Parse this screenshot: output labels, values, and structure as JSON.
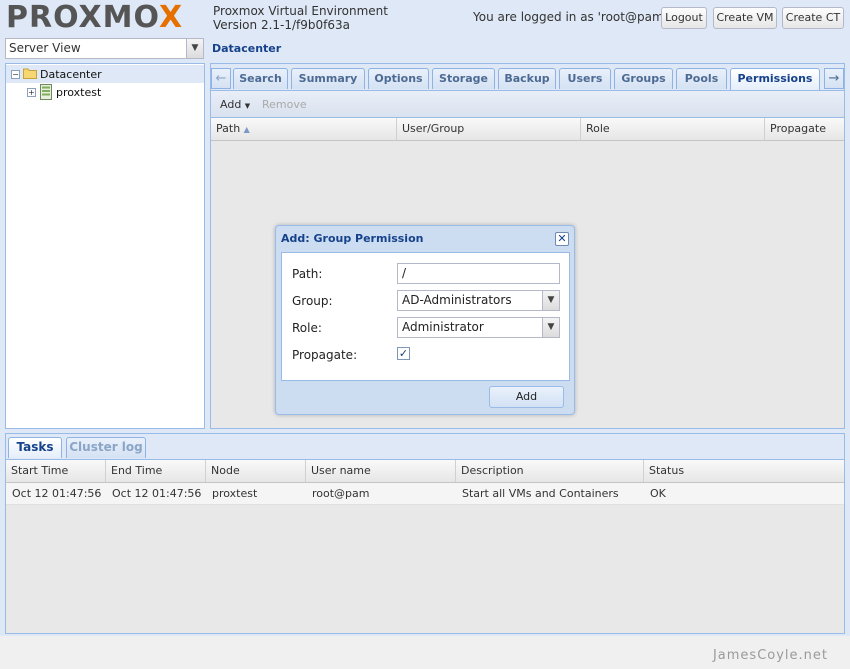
{
  "header": {
    "logo_main": "PROXMO",
    "logo_x": "X",
    "version_line1": "Proxmox Virtual Environment",
    "version_line2": "Version 2.1-1/f9b0f63a",
    "login_text": "You are logged in as 'root@pam'",
    "logout_label": "Logout",
    "create_vm_label": "Create VM",
    "create_ct_label": "Create CT"
  },
  "server_view": {
    "value": "Server View"
  },
  "tree": {
    "items": [
      {
        "label": "Datacenter",
        "icon": "folder-icon",
        "toggle": "−"
      },
      {
        "label": "proxtest",
        "icon": "server-icon",
        "toggle": "+"
      }
    ]
  },
  "main": {
    "title": "Datacenter",
    "tabs": [
      "Search",
      "Summary",
      "Options",
      "Storage",
      "Backup",
      "Users",
      "Groups",
      "Pools",
      "Permissions"
    ],
    "active_tab": "Permissions",
    "toolbar": {
      "add_label": "Add",
      "remove_label": "Remove"
    },
    "columns": [
      "Path",
      "User/Group",
      "Role",
      "Propagate"
    ]
  },
  "dialog": {
    "title": "Add: Group Permission",
    "fields": {
      "path_label": "Path:",
      "path_value": "/",
      "group_label": "Group:",
      "group_value": "AD-Administrators",
      "role_label": "Role:",
      "role_value": "Administrator",
      "propagate_label": "Propagate:",
      "propagate_checked": true
    },
    "add_button": "Add"
  },
  "bottom": {
    "tabs": [
      "Tasks",
      "Cluster log"
    ],
    "active_tab": "Tasks",
    "columns": [
      "Start Time",
      "End Time",
      "Node",
      "User name",
      "Description",
      "Status"
    ],
    "rows": [
      [
        "Oct 12 01:47:56",
        "Oct 12 01:47:56",
        "proxtest",
        "root@pam",
        "Start all VMs and Containers",
        "OK"
      ]
    ]
  },
  "watermark": "JamesCoyle.net",
  "colors": {
    "accent": "#15428b",
    "panel_bg": "#dfe8f6",
    "border": "#99bbe8",
    "logo_x": "#e57000"
  }
}
